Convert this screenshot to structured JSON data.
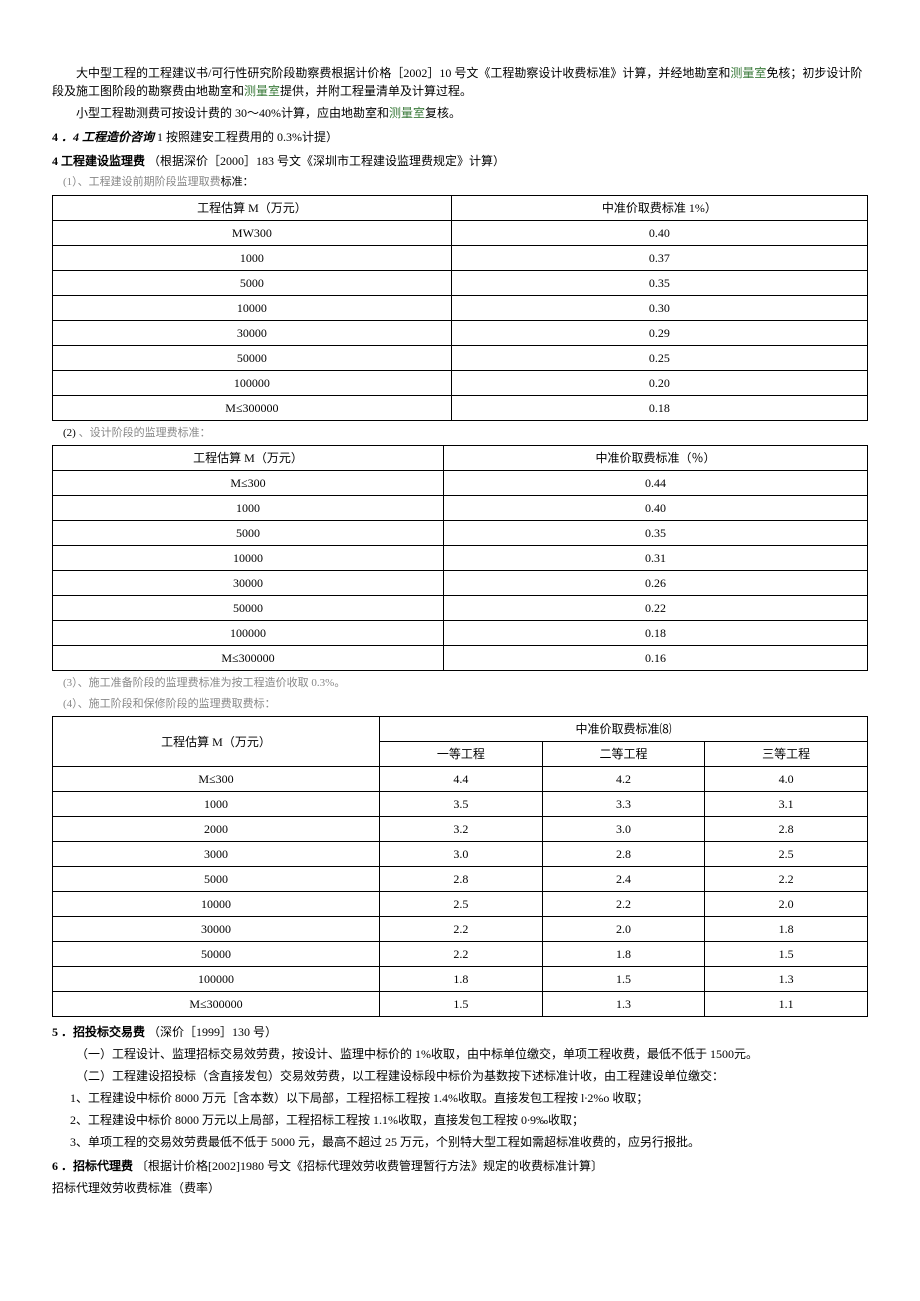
{
  "p1a": "大中型工程的工程建议书/可行性研究阶段勘察费根据计价格［2002］10 号文《工程勘察设计收费标准》计算，并经地勘室和",
  "p1b": "测量室",
  "p1c": "免核；初步设计阶段及施工图阶段的勘察费由地勘室和",
  "p1d": "测量室",
  "p1e": "提供，并附工程量清单及计算过程。",
  "p2a": "小型工程勘测费可按设计费的 30〜40%计算，应由地勘室和",
  "p2b": "测量室",
  "p2c": "复核。",
  "h44a": "4",
  "h44b": "．4 工程造价咨询",
  "h44c": "1 按照建安工程费用的 0.3%计提）",
  "h4a": "4 工程建设监理费",
  "h4b": "（根据深价［2000］183 号文《深圳市工程建设监理费规定》计算）",
  "s1": "(1）、工程建设前期阶段监理取费",
  "s1b": "标准：",
  "t1": {
    "h1": "工程估算 M（万元）",
    "h2": "中准价取费标准 1%）",
    "rows": [
      [
        "MW300",
        "0.40"
      ],
      [
        "1000",
        "0.37"
      ],
      [
        "5000",
        "0.35"
      ],
      [
        "10000",
        "0.30"
      ],
      [
        "30000",
        "0.29"
      ],
      [
        "50000",
        "0.25"
      ],
      [
        "100000",
        "0.20"
      ],
      [
        "M≤300000",
        "0.18"
      ]
    ]
  },
  "s2a": "(2)",
  "s2b": " 、设计阶段的监理费标准：",
  "t2": {
    "h1": "工程估算 M（万元）",
    "h2": "中准价取费标准（％）",
    "rows": [
      [
        "M≤300",
        "0.44"
      ],
      [
        "1000",
        "0.40"
      ],
      [
        "5000",
        "0.35"
      ],
      [
        "10000",
        "0.31"
      ],
      [
        "30000",
        "0.26"
      ],
      [
        "50000",
        "0.22"
      ],
      [
        "100000",
        "0.18"
      ],
      [
        "M≤300000",
        "0.16"
      ]
    ]
  },
  "s3": "(3）、施工准备阶段的监理费标准为按工程造价收取 0.3%。",
  "s4": "(4）、施工阶段和保修阶段的监理费取费标：",
  "t3": {
    "h1": "工程估算 M（万元）",
    "h2": "中准价取费标准⑻",
    "c1": "一等工程",
    "c2": "二等工程",
    "c3": "三等工程",
    "rows": [
      [
        "M≤300",
        "4.4",
        "4.2",
        "4.0"
      ],
      [
        "1000",
        "3.5",
        "3.3",
        "3.1"
      ],
      [
        "2000",
        "3.2",
        "3.0",
        "2.8"
      ],
      [
        "3000",
        "3.0",
        "2.8",
        "2.5"
      ],
      [
        "5000",
        "2.8",
        "2.4",
        "2.2"
      ],
      [
        "10000",
        "2.5",
        "2.2",
        "2.0"
      ],
      [
        "30000",
        "2.2",
        "2.0",
        "1.8"
      ],
      [
        "50000",
        "2.2",
        "1.8",
        "1.5"
      ],
      [
        "100000",
        "1.8",
        "1.5",
        "1.3"
      ],
      [
        "M≤300000",
        "1.5",
        "1.3",
        "1.1"
      ]
    ]
  },
  "h5a": "5",
  "h5b": "．招投标交易费",
  "h5c": "（深价［1999］130 号）",
  "p5_1": "（一）工程设计、监理招标交易效劳费，按设计、监理中标价的 1%收取，由中标单位缴交，单项工程收费，最低不低于 1500元。",
  "p5_2": "（二）工程建设招投标（含直接发包）交易效劳费，以工程建设标段中标价为基数按下述标准计收，由工程建设单位缴交：",
  "p5_3": "1、工程建设中标价 8000 万元［含本数）以下局部，工程招标工程按 1.4%收取。直接发包工程按 l∙2%o 收取；",
  "p5_4": "2、工程建设中标价 8000 万元以上局部，工程招标工程按 1.1%收取，直接发包工程按 0∙9‰收取；",
  "p5_5": "3、单项工程的交易效劳费最低不低于 5000 元，最高不超过 25 万元，个别特大型工程如需超标准收费的，应另行报批。",
  "h6a": "6",
  "h6b": "．招标代理费",
  "h6c": "〔根据计价格[2002]1980 号文《招标代理效劳收费管理暂行方法》规定的收费标准计算〕",
  "p6": "招标代理效劳收费标准（费率）"
}
